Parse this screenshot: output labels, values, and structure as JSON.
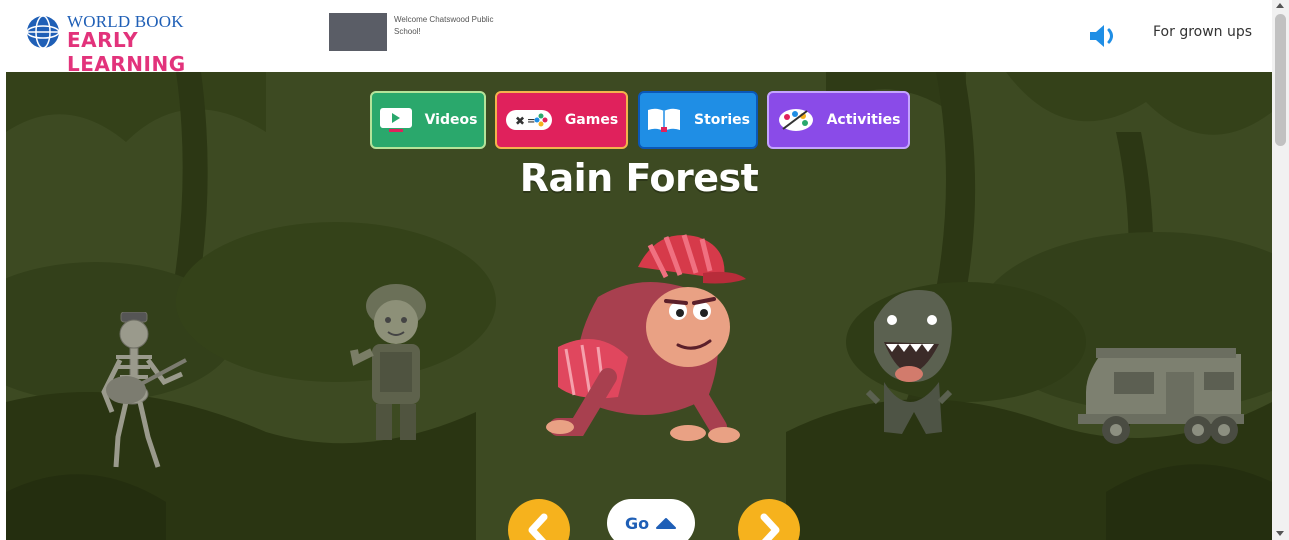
{
  "header": {
    "logo_top": "WORLD BOOK",
    "logo_bottom": "EARLY LEARNING",
    "school_welcome": "Welcome Chatswood Public School!",
    "sound_icon": "speaker-icon",
    "grown_ups_label": "For grown ups"
  },
  "categories": [
    {
      "label": "Videos",
      "icon": "video-icon",
      "color": "#2aa86c"
    },
    {
      "label": "Games",
      "icon": "gamepad-icon",
      "color": "#e0215c"
    },
    {
      "label": "Stories",
      "icon": "book-icon",
      "color": "#1f8ee5"
    },
    {
      "label": "Activities",
      "icon": "palette-icon",
      "color": "#8a4be8"
    }
  ],
  "main": {
    "title": "Rain Forest",
    "go_label": "Go",
    "characters": [
      "skeleton",
      "soldier",
      "gorilla",
      "dinosaur",
      "camper-van"
    ]
  },
  "colors": {
    "stage_bg": "#3d4a22",
    "nav_button": "#f6b21d",
    "brand_blue": "#1f5fb6",
    "brand_pink": "#e2337b"
  }
}
